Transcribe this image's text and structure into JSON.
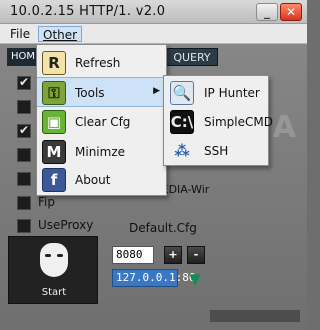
{
  "window": {
    "title": "10.0.2.15  HTTP/1.  v2.0",
    "minimize_label": "_",
    "close_label": "✕"
  },
  "menubar": {
    "file": "File",
    "other": "Other"
  },
  "background": {
    "home_tab": "HOME",
    "query_tab": "QUERY",
    "checkboxes": [
      {
        "label": "",
        "checked": true
      },
      {
        "label": "",
        "checked": false
      },
      {
        "label": "",
        "checked": true
      },
      {
        "label": "",
        "checked": false
      },
      {
        "label": "",
        "checked": false
      },
      {
        "label": "",
        "checked": false
      },
      {
        "label": "Fip",
        "checked": false
      },
      {
        "label": "UseProxy",
        "checked": false
      }
    ],
    "start_label": "Start",
    "pedia_text": "PEDIA-Wir",
    "cfg_label": "Default.Cfg",
    "port_value": "8080",
    "plus_label": "+",
    "minus_label": "-",
    "address_value": "127.0.0.1:80"
  },
  "other_menu": {
    "items": [
      {
        "label": "Refresh",
        "icon": "refresh-icon",
        "glyph": "R"
      },
      {
        "label": "Tools",
        "icon": "key-icon",
        "glyph": "⚿"
      },
      {
        "label": "Clear Cfg",
        "icon": "bucket-icon",
        "glyph": "▣"
      },
      {
        "label": "Minimze",
        "icon": "minimize-icon",
        "glyph": "M"
      },
      {
        "label": "About",
        "icon": "facebook-icon",
        "glyph": "f"
      }
    ],
    "submenu_arrow": "▶"
  },
  "tools_submenu": {
    "items": [
      {
        "label": "IP Hunter",
        "icon": "search-icon",
        "glyph": "🔍"
      },
      {
        "label": "SimpleCMD",
        "icon": "cmd-icon",
        "glyph": "C:\\"
      },
      {
        "label": "SSH",
        "icon": "ssh-icon",
        "glyph": "⁂"
      }
    ]
  },
  "watermark": "SOFTPEDIA"
}
